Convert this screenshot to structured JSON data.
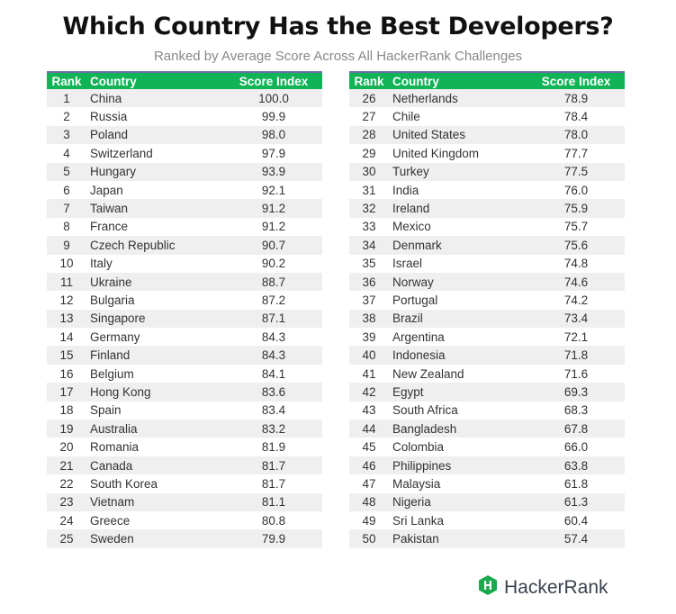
{
  "title": "Which Country Has the Best Developers?",
  "subtitle": "Ranked by Average Score Across All HackerRank Challenges",
  "columns": {
    "rank": "Rank",
    "country": "Country",
    "score": "Score Index"
  },
  "colors": {
    "header_green": "#10b356",
    "logo_green": "#1ba94c",
    "row_alt": "#efefef",
    "top_rule": "#6b6fa6"
  },
  "brand": {
    "icon": "hackerrank-hexagon-icon",
    "name": "HackerRank"
  },
  "chart_data": {
    "type": "table",
    "title": "Which Country Has the Best Developers?",
    "subtitle": "Ranked by Average Score Across All HackerRank Challenges",
    "columns": [
      "Rank",
      "Country",
      "Score Index"
    ],
    "left": [
      {
        "rank": "1",
        "country": "China",
        "score": "100.0"
      },
      {
        "rank": "2",
        "country": "Russia",
        "score": "99.9"
      },
      {
        "rank": "3",
        "country": "Poland",
        "score": "98.0"
      },
      {
        "rank": "4",
        "country": "Switzerland",
        "score": "97.9"
      },
      {
        "rank": "5",
        "country": "Hungary",
        "score": "93.9"
      },
      {
        "rank": "6",
        "country": "Japan",
        "score": "92.1"
      },
      {
        "rank": "7",
        "country": "Taiwan",
        "score": "91.2"
      },
      {
        "rank": "8",
        "country": "France",
        "score": "91.2"
      },
      {
        "rank": "9",
        "country": "Czech Republic",
        "score": "90.7"
      },
      {
        "rank": "10",
        "country": "Italy",
        "score": "90.2"
      },
      {
        "rank": "11",
        "country": "Ukraine",
        "score": "88.7"
      },
      {
        "rank": "12",
        "country": "Bulgaria",
        "score": "87.2"
      },
      {
        "rank": "13",
        "country": "Singapore",
        "score": "87.1"
      },
      {
        "rank": "14",
        "country": "Germany",
        "score": "84.3"
      },
      {
        "rank": "15",
        "country": "Finland",
        "score": "84.3"
      },
      {
        "rank": "16",
        "country": "Belgium",
        "score": "84.1"
      },
      {
        "rank": "17",
        "country": "Hong Kong",
        "score": "83.6"
      },
      {
        "rank": "18",
        "country": "Spain",
        "score": "83.4"
      },
      {
        "rank": "19",
        "country": "Australia",
        "score": "83.2"
      },
      {
        "rank": "20",
        "country": "Romania",
        "score": "81.9"
      },
      {
        "rank": "21",
        "country": "Canada",
        "score": "81.7"
      },
      {
        "rank": "22",
        "country": "South Korea",
        "score": "81.7"
      },
      {
        "rank": "23",
        "country": "Vietnam",
        "score": "81.1"
      },
      {
        "rank": "24",
        "country": "Greece",
        "score": "80.8"
      },
      {
        "rank": "25",
        "country": "Sweden",
        "score": "79.9"
      }
    ],
    "right": [
      {
        "rank": "26",
        "country": "Netherlands",
        "score": "78.9"
      },
      {
        "rank": "27",
        "country": "Chile",
        "score": "78.4"
      },
      {
        "rank": "28",
        "country": "United States",
        "score": "78.0"
      },
      {
        "rank": "29",
        "country": "United Kingdom",
        "score": "77.7"
      },
      {
        "rank": "30",
        "country": "Turkey",
        "score": "77.5"
      },
      {
        "rank": "31",
        "country": "India",
        "score": "76.0"
      },
      {
        "rank": "32",
        "country": "Ireland",
        "score": "75.9"
      },
      {
        "rank": "33",
        "country": "Mexico",
        "score": "75.7"
      },
      {
        "rank": "34",
        "country": "Denmark",
        "score": "75.6"
      },
      {
        "rank": "35",
        "country": "Israel",
        "score": "74.8"
      },
      {
        "rank": "36",
        "country": "Norway",
        "score": "74.6"
      },
      {
        "rank": "37",
        "country": "Portugal",
        "score": "74.2"
      },
      {
        "rank": "38",
        "country": "Brazil",
        "score": "73.4"
      },
      {
        "rank": "39",
        "country": "Argentina",
        "score": "72.1"
      },
      {
        "rank": "40",
        "country": "Indonesia",
        "score": "71.8"
      },
      {
        "rank": "41",
        "country": "New Zealand",
        "score": "71.6"
      },
      {
        "rank": "42",
        "country": "Egypt",
        "score": "69.3"
      },
      {
        "rank": "43",
        "country": "South Africa",
        "score": "68.3"
      },
      {
        "rank": "44",
        "country": "Bangladesh",
        "score": "67.8"
      },
      {
        "rank": "45",
        "country": "Colombia",
        "score": "66.0"
      },
      {
        "rank": "46",
        "country": "Philippines",
        "score": "63.8"
      },
      {
        "rank": "47",
        "country": "Malaysia",
        "score": "61.8"
      },
      {
        "rank": "48",
        "country": "Nigeria",
        "score": "61.3"
      },
      {
        "rank": "49",
        "country": "Sri Lanka",
        "score": "60.4"
      },
      {
        "rank": "50",
        "country": "Pakistan",
        "score": "57.4"
      }
    ]
  }
}
